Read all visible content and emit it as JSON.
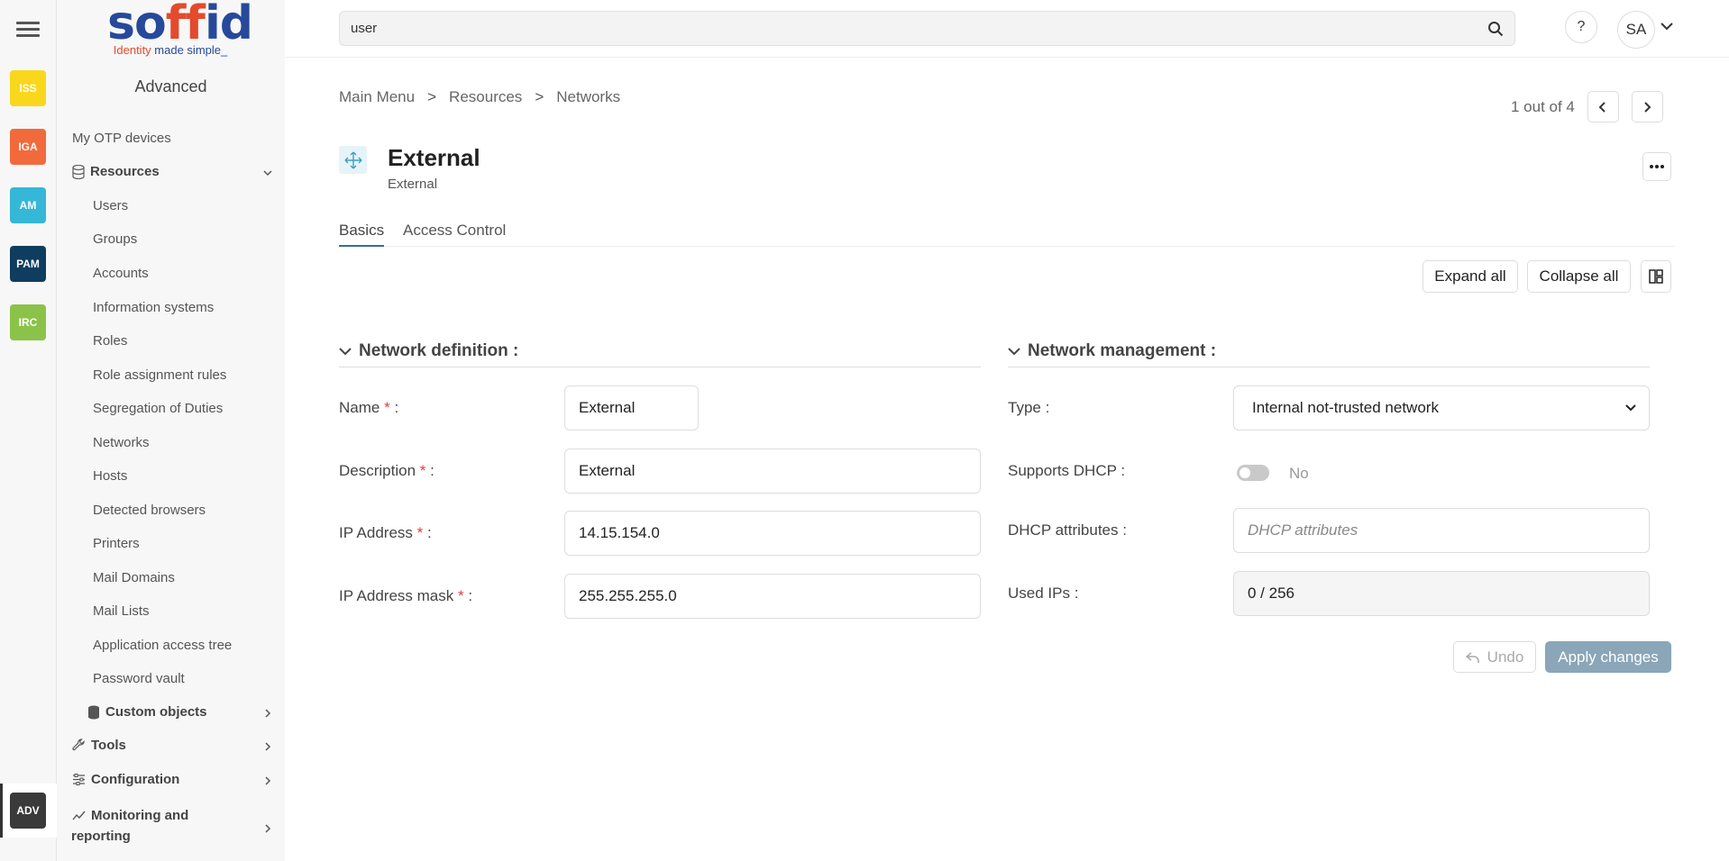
{
  "rail": {
    "apps": [
      {
        "label": "ISS",
        "color": "#f9d71c"
      },
      {
        "label": "IGA",
        "color": "#f26a3c"
      },
      {
        "label": "AM",
        "color": "#35b7d8"
      },
      {
        "label": "PAM",
        "color": "#0e3d5f"
      },
      {
        "label": "IRC",
        "color": "#8bc34a"
      },
      {
        "label": "ADV",
        "color": "#3a3a3a"
      }
    ]
  },
  "logo": {
    "part1": "so",
    "part2": "ff",
    "part3": "id",
    "tagline_a": "Identity ",
    "tagline_b": "made simple_"
  },
  "sidebar": {
    "title": "Advanced",
    "otp": "My OTP devices",
    "resources": "Resources",
    "items": [
      "Users",
      "Groups",
      "Accounts",
      "Information systems",
      "Roles",
      "Role assignment rules",
      "Segregation of Duties",
      "Networks",
      "Hosts",
      "Detected browsers",
      "Printers",
      "Mail Domains",
      "Mail Lists",
      "Application access tree",
      "Password vault"
    ],
    "custom_objects": "Custom objects",
    "tools": "Tools",
    "configuration": "Configuration",
    "monitoring_line1": "Monitoring and",
    "monitoring_line2": "reporting"
  },
  "topbar": {
    "search_value": "user",
    "help": "?",
    "avatar": "SA"
  },
  "breadcrumb": {
    "items": [
      "Main Menu",
      "Resources",
      "Networks"
    ],
    "sep": ">"
  },
  "pager": {
    "text": "1 out of 4"
  },
  "object": {
    "title": "External",
    "subtitle": "External"
  },
  "tabs": [
    "Basics",
    "Access Control"
  ],
  "toolbar": {
    "expand": "Expand all",
    "collapse": "Collapse all"
  },
  "network_definition": {
    "title": "Network definition :",
    "fields": [
      {
        "label": "Name",
        "value": "External"
      },
      {
        "label": "Description",
        "value": "External"
      },
      {
        "label": "IP Address",
        "value": "14.15.154.0"
      },
      {
        "label": "IP Address mask",
        "value": "255.255.255.0"
      }
    ],
    "suffix": " :",
    "required_mark": "*"
  },
  "network_management": {
    "title": "Network management :",
    "type_label": "Type :",
    "type_value": "Internal not-trusted network",
    "dhcp_label": "Supports DHCP :",
    "dhcp_value": "No",
    "dhcp_attr_label": "DHCP attributes :",
    "dhcp_attr_placeholder": "DHCP attributes",
    "used_ips_label": "Used IPs :",
    "used_ips_value": "0 / 256"
  },
  "actions": {
    "undo": "Undo",
    "apply": "Apply changes"
  }
}
